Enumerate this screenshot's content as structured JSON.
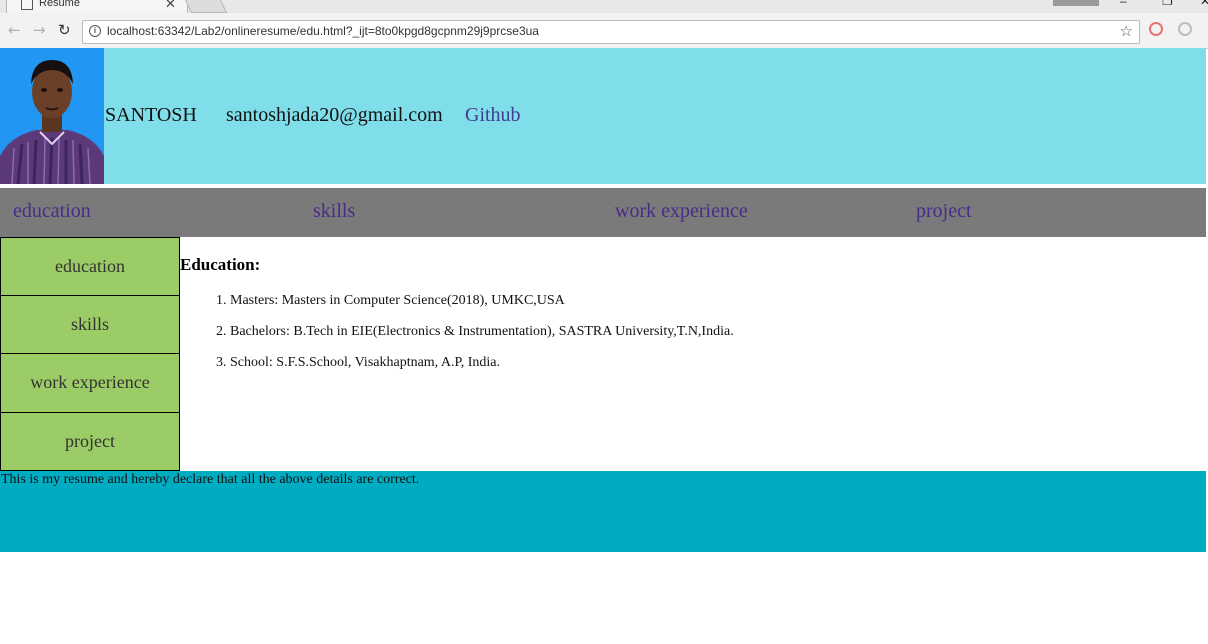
{
  "browser": {
    "tab_title": "Resume",
    "url": "localhost:63342/Lab2/onlineresume/edu.html?_ijt=8to0kpgd8gcpnm29j9prcse3ua"
  },
  "header": {
    "name": "SANTOSH",
    "email": "santoshjada20@gmail.com",
    "link": "Github"
  },
  "topnav": [
    "education",
    "skills",
    "work experience",
    "project"
  ],
  "sidenav": [
    "education",
    "skills",
    "work experience",
    "project"
  ],
  "content": {
    "heading": "Education:",
    "items": [
      "Masters: Masters in Computer Science(2018), UMKC,USA",
      "Bachelors: B.Tech in EIE(Electronics & Instrumentation), SASTRA University,T.N,India.",
      "School: S.F.S.School, Visakhaptnam, A.P, India."
    ]
  },
  "footer": {
    "text": "This is my resume and hereby declare that all the above details are correct."
  },
  "colors": {
    "header_bg": "#80deea",
    "nav_bg": "#7a7a7a",
    "sidenav_bg": "#9ccc65",
    "footer_bg": "#00acc1",
    "link": "#4a2a8a"
  },
  "icons": [
    "back-arrow-icon",
    "forward-arrow-icon",
    "reload-icon",
    "info-icon",
    "star-icon",
    "extension-icon"
  ]
}
